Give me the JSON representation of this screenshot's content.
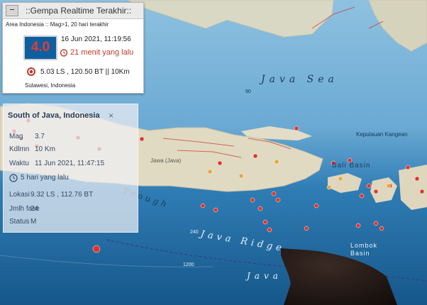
{
  "realtime_panel": {
    "collapse_label": "−",
    "title": "::Gempa Realtime Terakhir::",
    "area_filter": "Area Indonesia :: Mag>1, 20 hari terakhir",
    "magnitude": "4.0",
    "datetime": "16 Jun 2021, 11:19:56",
    "time_ago": "21 menit yang lalu",
    "coordinates": "5.03 LS , 120.50 BT || 10Km",
    "location": "Sulawesi, Indonesia"
  },
  "info_popup": {
    "title": "South of Java, Indonesia",
    "close_label": "×",
    "rows": [
      {
        "label": "Mag",
        "value": "3.7"
      },
      {
        "label": "Kdlmn",
        "value": "10 Km"
      },
      {
        "label": "Waktu",
        "value": "11 Jun 2021, 11:47:15"
      }
    ],
    "time_ago": "5 hari yang lalu",
    "rows2": [
      {
        "label": "Lokasi",
        "value": "9.32 LS , 112.76 BT"
      },
      {
        "label": "Jmlh fase",
        "value": "24"
      },
      {
        "label": "Status",
        "value": "M"
      }
    ]
  },
  "map_labels": {
    "java_sea": "Java Sea",
    "bali_basin": "Bali Basin",
    "lombok_basin": "Lombok Basin",
    "java_ridge": "Java Ridge",
    "java_trough": "Java",
    "trough": "Trough",
    "java_island": "Jawa (Java)",
    "kepulauan_kangean": "Kepulauan Kangean",
    "depth_90": "90",
    "depth_240": "240",
    "depth_1200": "1200"
  },
  "colors": {
    "sea_deep": "#1a5f8e",
    "sea_shallow": "#7fb6d9",
    "land": "#d9d2b8",
    "quake_red": "#e2312c",
    "quake_orange": "#e8a33c",
    "mag_box": "#0e5ea0"
  }
}
